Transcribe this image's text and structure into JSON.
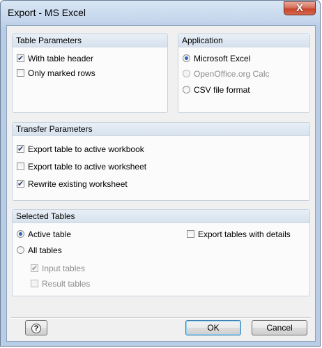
{
  "window": {
    "title": "Export - MS Excel",
    "close_label": "X"
  },
  "table_parameters": {
    "header": "Table Parameters",
    "with_table_header": {
      "label": "With table header",
      "checked": true
    },
    "only_marked_rows": {
      "label": "Only marked rows",
      "checked": false
    }
  },
  "application": {
    "header": "Application",
    "microsoft_excel": {
      "label": "Microsoft Excel",
      "selected": true
    },
    "openoffice_calc": {
      "label": "OpenOffice.org Calc",
      "selected": false,
      "enabled": false
    },
    "csv_file_format": {
      "label": "CSV file format",
      "selected": false
    }
  },
  "transfer_parameters": {
    "header": "Transfer Parameters",
    "export_to_active_workbook": {
      "label": "Export table to active workbook",
      "checked": true
    },
    "export_to_active_worksheet": {
      "label": "Export table to active worksheet",
      "checked": false
    },
    "rewrite_existing_worksheet": {
      "label": "Rewrite existing worksheet",
      "checked": true
    }
  },
  "selected_tables": {
    "header": "Selected Tables",
    "active_table": {
      "label": "Active table",
      "selected": true
    },
    "all_tables": {
      "label": "All tables",
      "selected": false
    },
    "input_tables": {
      "label": "Input tables",
      "checked": true,
      "enabled": false
    },
    "result_tables": {
      "label": "Result tables",
      "checked": false,
      "enabled": false
    },
    "export_with_details": {
      "label": "Export tables with details",
      "checked": false
    }
  },
  "buttons": {
    "ok": "OK",
    "cancel": "Cancel",
    "help_icon": "help-icon"
  },
  "colors": {
    "title_bar": "#c4d6ec",
    "close_button": "#c8442c",
    "group_header": "#dfe7f1"
  }
}
